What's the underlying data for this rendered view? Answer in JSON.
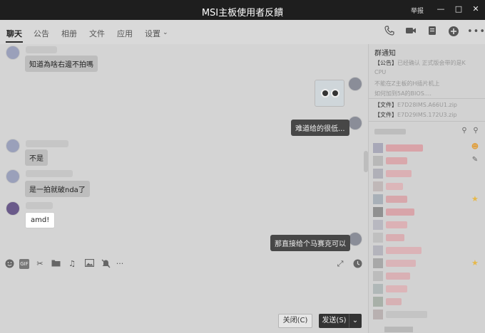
{
  "window": {
    "title": "MSI主板使用者反饋",
    "report_label": "举报",
    "min_icon": "minimize-icon",
    "max_icon": "maximize-icon",
    "close_icon": "close-icon"
  },
  "tabs": [
    {
      "label": "聊天",
      "active": true
    },
    {
      "label": "公告"
    },
    {
      "label": "相册"
    },
    {
      "label": "文件"
    },
    {
      "label": "应用"
    },
    {
      "label": "设置"
    }
  ],
  "tab_tools": [
    "phone-icon",
    "video-icon",
    "screen-share-icon",
    "add-icon",
    "more-icon"
  ],
  "messages": [
    {
      "side": "in",
      "text": "知道為啥右邊不拍嗎"
    },
    {
      "side": "out",
      "type": "sticker"
    },
    {
      "side": "out",
      "text": "难道给的很低..."
    },
    {
      "side": "in",
      "text": "不是"
    },
    {
      "side": "in",
      "text": "是一拍就破nda了"
    },
    {
      "side": "in",
      "text": "amd!"
    },
    {
      "side": "out",
      "text": "那直接给个马赛克可以"
    }
  ],
  "input_toolbar": [
    "emoji-icon",
    "gif-icon",
    "scissors-icon",
    "folder-icon",
    "music-icon",
    "image-icon",
    "mute-icon",
    "more-icon",
    "expand-icon",
    "history-icon"
  ],
  "buttons": {
    "close": "关闭(C)",
    "send": "发送(S)"
  },
  "notice": {
    "title": "群通知",
    "announcement_prefix": "【公告】",
    "announcement_line1": "已经确认 正式版会带的是K",
    "announcement_line2": "CPU",
    "announcement_line3": "不能在Z主板的H插片机上",
    "announcement_line4": "如何加到5A的BIOS....",
    "file_prefix": "【文件】",
    "file1": "E7D28IMS.A66U1.zip",
    "file2": "E7D29IMS.172U3.zip"
  },
  "colors": {
    "titlebar": "#1e1e1e",
    "bubble_out": "#474747",
    "bubble_in": "#bdbdbd",
    "member_star": "#e6b84a"
  }
}
